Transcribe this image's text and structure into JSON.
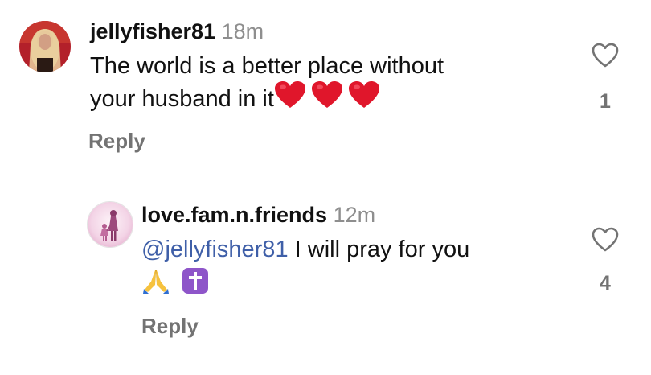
{
  "comments": [
    {
      "username": "jellyfisher81",
      "time": "18m",
      "text_line1": "The world is a better place without",
      "text_line2": "your husband in it",
      "emojis": [
        "heart-emoji",
        "heart-emoji",
        "heart-emoji"
      ],
      "reply_label": "Reply",
      "like_count": "1"
    },
    {
      "username": "love.fam.n.friends",
      "time": "12m",
      "mention": "@jellyfisher81",
      "text": " I will pray for you",
      "emojis": [
        "folded-hands-emoji",
        "latin-cross-emoji"
      ],
      "reply_label": "Reply",
      "like_count": "4"
    }
  ],
  "colors": {
    "username": "#111111",
    "time": "#8e8e8e",
    "mention": "#3f5fa8",
    "reply": "#737373",
    "heart_emoji": "#e0162b",
    "cross_emoji_bg": "#8e55c9"
  },
  "icons": [
    "heart-outline-icon"
  ]
}
